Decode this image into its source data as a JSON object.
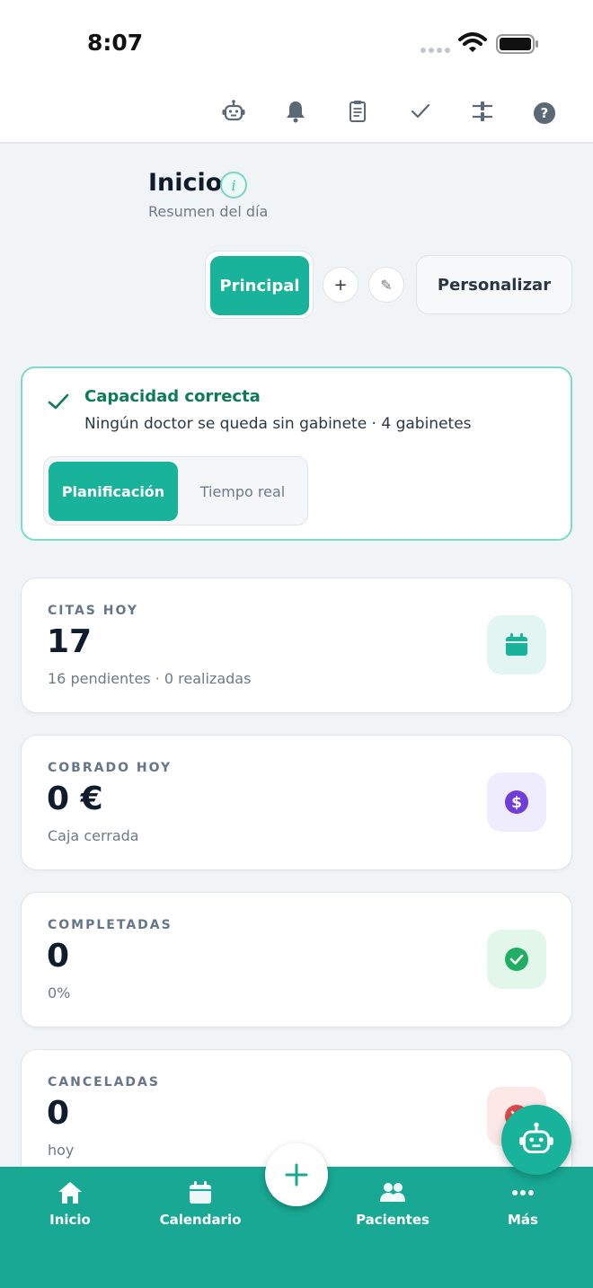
{
  "status_bar": {
    "time": "8:07"
  },
  "toolbar": {
    "icons": [
      "robot-icon",
      "bell-icon",
      "clipboard-icon",
      "check-icon",
      "sliders-icon",
      "help-icon"
    ],
    "help_glyph": "?"
  },
  "header": {
    "title": "Inicio",
    "info_glyph": "i",
    "subtitle": "Resumen del día"
  },
  "dashboard_tabs": {
    "active_label": "Principal",
    "add_glyph": "+",
    "edit_glyph": "✎",
    "personalize_label": "Personalizar"
  },
  "capacity": {
    "title": "Capacidad correcta",
    "description": "Ningún doctor se queda sin gabinete · 4 gabinetes",
    "modes": [
      "Planificación",
      "Tiempo real"
    ],
    "active_mode": "Planificación"
  },
  "stats": [
    {
      "label": "CITAS HOY",
      "value": "17",
      "sub": "16 pendientes · 0 realizadas",
      "icon": "calendar-icon",
      "badge_bg": "#e3f5f1",
      "icon_color": "#19b29b"
    },
    {
      "label": "COBRADO HOY",
      "value": "0 €",
      "sub": "Caja cerrada",
      "icon": "dollar-icon",
      "badge_bg": "#efecfd",
      "icon_color": "#6f3ed8"
    },
    {
      "label": "COMPLETADAS",
      "value": "0",
      "sub": "0%",
      "icon": "check-circle-icon",
      "badge_bg": "#e3f6ea",
      "icon_color": "#1fae62"
    },
    {
      "label": "CANCELADAS",
      "value": "0",
      "sub": "hoy",
      "icon": "cancel-icon",
      "badge_bg": "#fde8e8",
      "icon_color": "#e04848"
    }
  ],
  "bottom_nav": {
    "items": [
      {
        "label": "Inicio",
        "icon": "home-icon"
      },
      {
        "label": "Calendario",
        "icon": "calendar-icon"
      },
      {
        "label": "Pacientes",
        "icon": "users-icon"
      },
      {
        "label": "Más",
        "icon": "more-icon"
      }
    ]
  },
  "colors": {
    "accent": "#19b29b",
    "nav_bg": "#18a894",
    "success": "#0b7d55"
  }
}
